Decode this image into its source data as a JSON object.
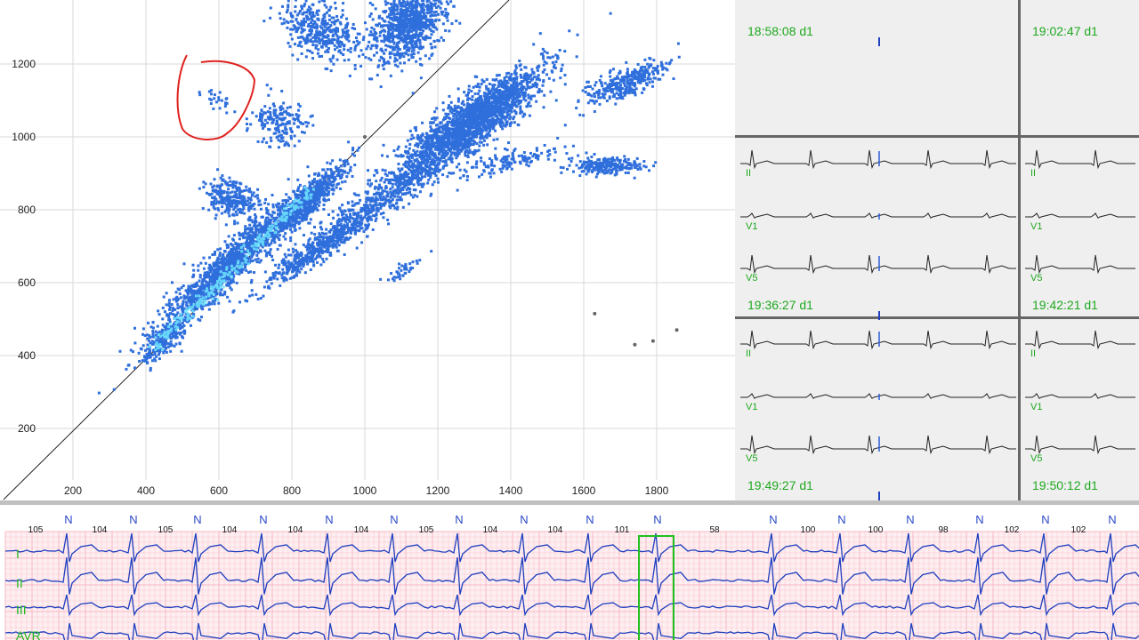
{
  "scatter": {
    "x_ticks": [
      "200",
      "400",
      "600",
      "800",
      "1000",
      "1200",
      "1400",
      "1600",
      "1800"
    ],
    "y_ticks": [
      "1200",
      "1000",
      "800",
      "600",
      "400",
      "200"
    ],
    "point_color": "#2f6fdc",
    "core_color": "#6fe6ff",
    "annotation_color": "#e0221f",
    "diagonal_color": "#222222"
  },
  "strips": {
    "lead_labels": [
      "II",
      "V1",
      "V5"
    ],
    "label_color": "#1fa81f",
    "timestamps": [
      [
        "18:58:08 d1",
        "19:02:47 d1"
      ],
      [
        "19:36:27 d1",
        "19:42:21 d1"
      ],
      [
        "19:49:27 d1",
        "19:50:12 d1"
      ]
    ]
  },
  "ecg": {
    "leads": [
      "I",
      "II",
      "III",
      "AVR"
    ],
    "beat_label": "N",
    "rates": [
      {
        "text": "105",
        "x": 40
      },
      {
        "text": "104",
        "x": 112
      },
      {
        "text": "105",
        "x": 186
      },
      {
        "text": "104",
        "x": 258
      },
      {
        "text": "104",
        "x": 332
      },
      {
        "text": "104",
        "x": 406
      },
      {
        "text": "105",
        "x": 479
      },
      {
        "text": "104",
        "x": 551
      },
      {
        "text": "104",
        "x": 624
      },
      {
        "text": "101",
        "x": 699
      },
      {
        "text": "58",
        "x": 803
      },
      {
        "text": "100",
        "x": 908
      },
      {
        "text": "100",
        "x": 984
      },
      {
        "text": "98",
        "x": 1060
      },
      {
        "text": "102",
        "x": 1137
      },
      {
        "text": "102",
        "x": 1212
      }
    ],
    "beats_x": [
      77,
      150,
      222,
      296,
      370,
      443,
      516,
      589,
      663,
      739,
      869,
      946,
      1023,
      1101,
      1175,
      1250
    ],
    "highlight_beat": 9,
    "grid_color": "#f6b9c3",
    "trace_color": "#1f3fbf"
  }
}
